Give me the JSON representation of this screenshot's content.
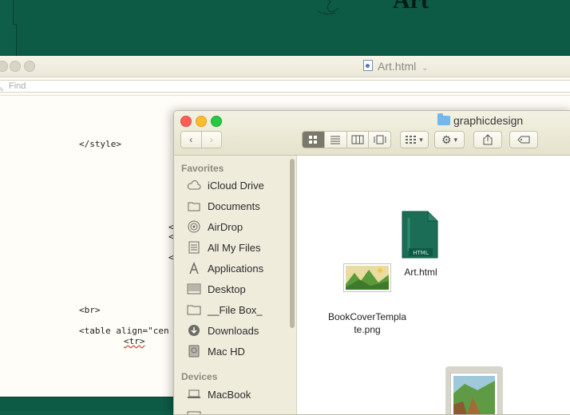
{
  "background_page": {
    "heading": "Art"
  },
  "editor": {
    "title": "Art.html",
    "find_placeholder": "Find",
    "code": {
      "style_close": "</style>",
      "br": "<br>",
      "table_open": "<table align=\"cen",
      "tr": "<tr>",
      "partial_1": "<",
      "partial_2": "<",
      "partial_3": "<"
    }
  },
  "finder": {
    "title": "graphicdesign",
    "sidebar": {
      "favorites_heading": "Favorites",
      "items": [
        {
          "label": "iCloud Drive",
          "icon": "cloud-icon"
        },
        {
          "label": "Documents",
          "icon": "documents-icon"
        },
        {
          "label": "AirDrop",
          "icon": "airdrop-icon"
        },
        {
          "label": "All My Files",
          "icon": "all-files-icon"
        },
        {
          "label": "Applications",
          "icon": "applications-icon"
        },
        {
          "label": "Desktop",
          "icon": "desktop-icon"
        },
        {
          "label": "__File Box_",
          "icon": "folder-icon"
        },
        {
          "label": "Downloads",
          "icon": "downloads-icon"
        },
        {
          "label": "Mac HD",
          "icon": "hard-drive-icon"
        }
      ],
      "devices_heading": "Devices",
      "devices": [
        {
          "label": "MacBook",
          "icon": "laptop-icon"
        }
      ]
    },
    "files": [
      {
        "name": "Art.html",
        "icon": "html-file-icon"
      },
      {
        "name_line1": "BookCoverTempla",
        "name_line2": "te.png",
        "icon": "image-file-icon"
      }
    ],
    "html_badge": "HTML"
  }
}
